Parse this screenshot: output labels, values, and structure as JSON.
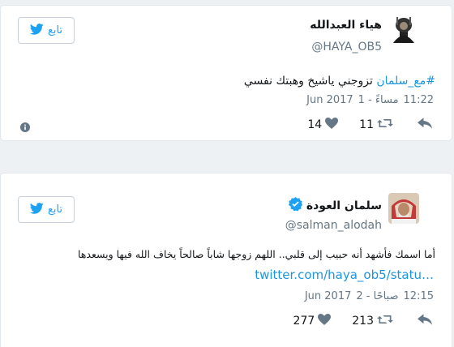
{
  "colors": {
    "accent": "#1da1f2",
    "link": "#1b95e0",
    "muted": "#657786",
    "border": "#e1e8ed",
    "verified": "#1da1f2"
  },
  "tweets": [
    {
      "follow_label": "تابع",
      "name": "هياء العبدالله",
      "verified": false,
      "handle": "@HAYA_OB5",
      "hashtag": "#مع_سلمان",
      "text": " تزوجني ياشيخ وهبتك نفسي",
      "time": "11:22",
      "time_suffix": "مساءً - 1",
      "month_year": "Jun 2017",
      "likes": "14",
      "retweets": "11",
      "icons": [
        "info-icon",
        "like-icon",
        "retweet-icon",
        "reply-icon"
      ]
    },
    {
      "follow_label": "تابع",
      "name": "سلمان العودة",
      "verified": true,
      "handle": "@salman_alodah",
      "text": "أما اسمك فأشهد أنه حبيب إلى قلبي.. اللهم زوجها شاباً صالحاً يخاف الله فيها ويسعدها",
      "link": "twitter.com/haya_ob5/statu…",
      "time": "12:15",
      "time_suffix": "صباحًا - 2",
      "month_year": "Jun 2017",
      "likes": "277",
      "retweets": "213",
      "icons": [
        "verified-badge-icon",
        "like-icon",
        "retweet-icon",
        "reply-icon"
      ]
    }
  ]
}
